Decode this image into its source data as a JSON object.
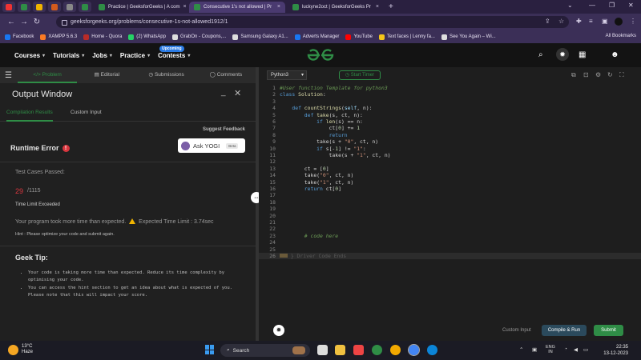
{
  "browser": {
    "tabs": [
      {
        "label": "Practice | GeeksforGeeks | A com",
        "active": false
      },
      {
        "label": "Consecutive 1's not allowed | Pr",
        "active": true
      },
      {
        "label": "luckyne2oct | GeeksforGeeks Pr",
        "active": false
      }
    ],
    "url": "geeksforgeeks.org/problems/consecutive-1s-not-allowed1912/1",
    "bookmarks": [
      "Facebook",
      "XAMPP 5.6.3",
      "Home - Quora",
      "(2) WhatsApp",
      "GrabOn - Coupons,...",
      "Samsung Galaxy A1...",
      "Adverts Manager",
      "YouTube",
      "Text faces | Lenny fa...",
      "See You Again – Wi..."
    ],
    "all_bookmarks": "All Bookmarks"
  },
  "site": {
    "nav": [
      "Courses",
      "Tutorials",
      "Jobs",
      "Practice",
      "Contests"
    ],
    "contests_badge": "Upcoming"
  },
  "toolbar": {
    "tabs": [
      "Problem",
      "Editorial",
      "Submissions",
      "Comments"
    ],
    "language": "Python3",
    "timer": "Start Timer"
  },
  "output": {
    "title": "Output Window",
    "tabs": [
      "Compilation Results",
      "Custom Input"
    ],
    "suggest_feedback": "Suggest Feedback",
    "status": "Runtime Error",
    "ask_yogi": "Ask YOGI",
    "beta": "Beta",
    "test_cases_label": "Test Cases Passed:",
    "passed": "29",
    "total": "/1115",
    "time_limit": "Time Limit Exceeded",
    "took_longer": "Your program took more time than expected.",
    "expected_limit": "Expected Time Limit : 3.74sec",
    "hint": "Hint : Please optimize your code and submit again.",
    "geek_tip_title": "Geek Tip:",
    "geek_tips": [
      "Your code is taking more time than expected. Reduce its time complexity by optimising your code.",
      "You can access the hint section to get an idea about what is expected of you. Please note that this will impact your score."
    ]
  },
  "editor": {
    "line_numbers": [
      "1",
      "2",
      "3",
      "4",
      "5",
      "6",
      "7",
      "8",
      "9",
      "10",
      "11",
      "12",
      "13",
      "14",
      "15",
      "16",
      "17",
      "18",
      "19",
      "20",
      "21",
      "22",
      "23",
      "24",
      "25",
      "26"
    ],
    "comment_template": "#User function Template for python3",
    "code_here": "# code here",
    "driver_fold": "} Driver Code Ends"
  },
  "footer": {
    "custom_input": "Custom Input",
    "compile_run": "Compile & Run",
    "submit": "Submit"
  },
  "taskbar": {
    "temperature": "13°C",
    "weather": "Haze",
    "search": "Search",
    "lang": "ENG",
    "region": "IN",
    "time": "22:35",
    "date": "13-12-2023"
  }
}
